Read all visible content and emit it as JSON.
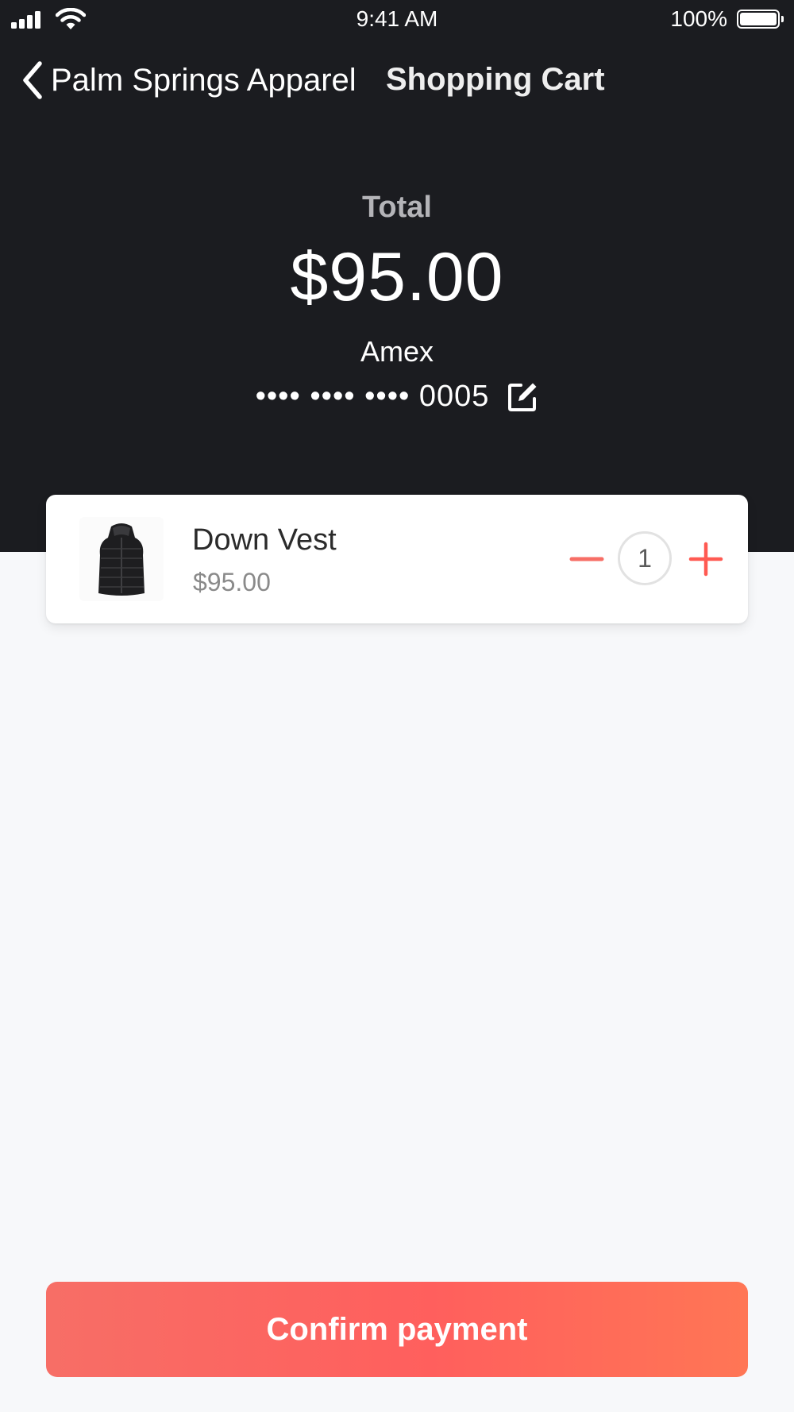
{
  "status_bar": {
    "time": "9:41 AM",
    "battery_percent": "100%",
    "icons": [
      "signal-icon",
      "wifi-icon",
      "battery-icon"
    ]
  },
  "nav": {
    "back_label": "Palm Springs Apparel",
    "back_icon": "chevron-left-icon",
    "title": "Shopping Cart"
  },
  "summary": {
    "total_label": "Total",
    "total_amount": "$95.00",
    "card_brand": "Amex",
    "card_number": "•••• •••• •••• 0005",
    "edit_icon": "edit-icon"
  },
  "cart": {
    "items": [
      {
        "name": "Down Vest",
        "price": "$95.00",
        "quantity": "1",
        "thumbnail_icon": "vest-icon"
      }
    ]
  },
  "confirm_button_label": "Confirm payment",
  "colors": {
    "header_bg": "#1b1c20",
    "page_bg": "#f7f8fa",
    "accent": "#ff5f5d",
    "minus": "#f76e66",
    "plus": "#ff5a52"
  }
}
